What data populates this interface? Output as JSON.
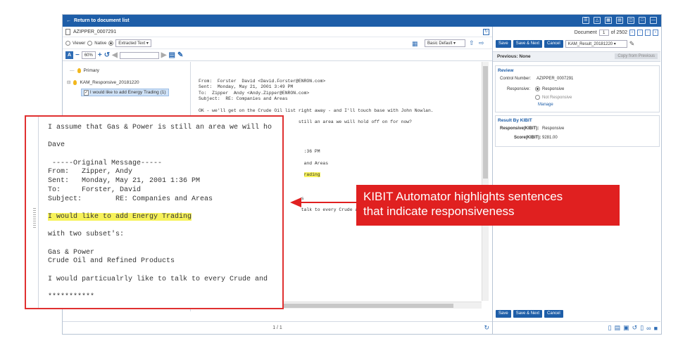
{
  "topbar": {
    "back_label": "Return to document list",
    "icons": [
      "list-icon",
      "org-icon",
      "grid-icon",
      "split-h-icon",
      "split-v-icon",
      "window-icon",
      "minimize-icon"
    ]
  },
  "document": {
    "file_name": "AZIPPER_0007291",
    "view_modes": [
      "Viewer",
      "Native",
      "Extracted Text"
    ],
    "selected_view": "Extracted Text",
    "zoom": "60%",
    "layout_select": "Basic Default",
    "page_indicator": "1 / 1"
  },
  "tree": {
    "nodes": [
      {
        "label": "Primary"
      },
      {
        "label": "KAM_Responsive_20181220"
      },
      {
        "label": "I would like to add Energy Trading (1)"
      }
    ]
  },
  "email": {
    "from": "From:  Forster  David <David.Forster@ENRON.com>",
    "sent": "Sent:  Monday, May 21, 2001 3:49 PM",
    "to": "To:  Zipper  Andy <Andy.Zipper@ENRON.com>",
    "subject": "Subject:  RE: Companies and Areas",
    "body1": "OK - we'll get on the Crude Oil list right away - and I'll touch base with John Nowlan.",
    "frag1": "still an area we will hold off on for now?",
    "frag2": ":36 PM",
    "frag3": "and Areas",
    "frag4": "rading",
    "frag5": "s",
    "frag6": "talk to every Crude and"
  },
  "zoom_view": {
    "lines": [
      "I assume that Gas & Power is still an area we will ho",
      "",
      "Dave",
      "",
      " -----Original Message-----",
      "From:   Zipper, Andy",
      "Sent:   Monday, May 21, 2001 1:36 PM",
      "To:     Forster, David",
      "Subject:        RE: Companies and Areas",
      ""
    ],
    "highlight": "I would like to add Energy Trading",
    "lines2": [
      "",
      "with two subset's:",
      "",
      "Gas & Power",
      "Crude Oil and Refined Products",
      "",
      "I would particualrly like to talk to every Crude and",
      "",
      "***********",
      "",
      "***********"
    ]
  },
  "right_panel": {
    "doc_label": "Document",
    "doc_number": "1",
    "doc_total": "of 2502",
    "buttons": [
      "Save",
      "Save & Next",
      "Cancel"
    ],
    "result_select": "KAM_Result_20181220",
    "previous": "Previous: None",
    "copy_prev": "Copy from Previous",
    "review": {
      "title": "Review",
      "control_label": "Control Number:",
      "control_value": "AZIPPER_0007291",
      "responsive_label": "Responsive:",
      "options": [
        "Responsive",
        "Not Responsive"
      ],
      "manage": "Manage"
    },
    "result": {
      "title": "Result By KIBIT",
      "responsive_label": "Responsive(KIBIT):",
      "responsive_value": "Responsive",
      "score_label": "Score(KIBIT):",
      "score_value": "9281.00"
    }
  },
  "annotation": {
    "text_line1": "KIBIT Automator highlights sentences",
    "text_line2": "that indicate responsiveness"
  }
}
